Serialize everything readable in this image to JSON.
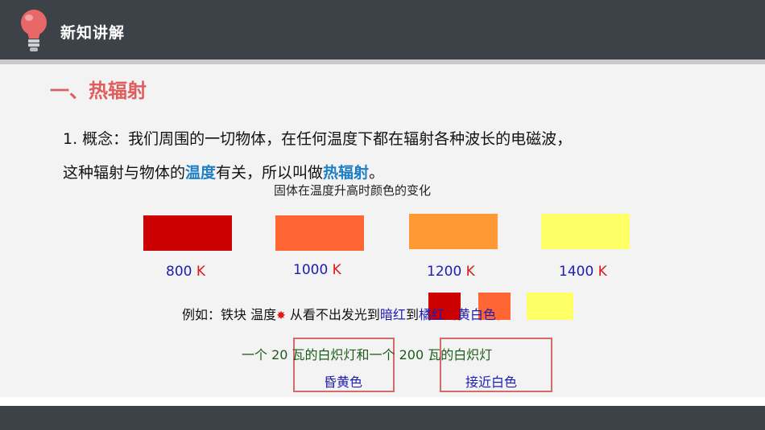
{
  "header": {
    "title": "新知讲解",
    "icon": "lightbulb-icon"
  },
  "section": {
    "title": "一、热辐射"
  },
  "concept": {
    "line1": "1. 概念：我们周围的一切物体，在任何温度下都在辐射各种波长的电磁波，",
    "line2_prefix": "这种辐射与物体的",
    "line2_highlight1": "温度",
    "line2_middle": "有关，所以叫做",
    "line2_highlight2": "热辐射",
    "line2_suffix": "。"
  },
  "chart": {
    "title": "固体在温度升高时颜色的变化",
    "swatches": [
      {
        "value": "800",
        "unit": "K",
        "color": "#cc0000"
      },
      {
        "value": "1000",
        "unit": "K",
        "color": "#ff6633"
      },
      {
        "value": "1200",
        "unit": "K",
        "color": "#ff9933"
      },
      {
        "value": "1400",
        "unit": "K",
        "color": "#ffff66"
      }
    ]
  },
  "example": {
    "prefix": "例如：铁块 温度",
    "star": "✸",
    "middle": " 从看不出发光到",
    "word1": "暗红",
    "to1": "到",
    "word2": "橘红",
    "to2": "到",
    "word3": "黄白色",
    "suffix": "。",
    "mini_colors": [
      "#cc0000",
      "#ff6633",
      "#ffff66"
    ]
  },
  "bulbs": {
    "line": "一个 20 瓦的白炽灯和一个 200 瓦的白炽灯",
    "label1": "昏黄色",
    "label2": "接近白色"
  },
  "colors": {
    "accent_red": "#e05d5d",
    "highlight_blue": "#1f7fc4",
    "label_blue": "#1d1db5",
    "dark_bar": "#3d4249"
  }
}
